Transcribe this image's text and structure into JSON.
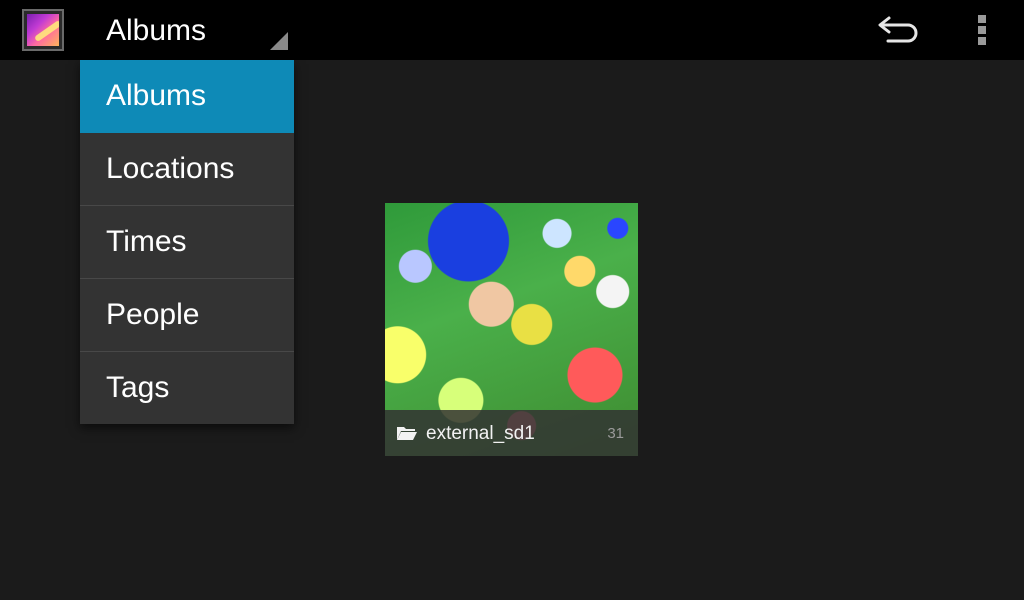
{
  "action_bar": {
    "title": "Albums",
    "app_icon": "gallery-icon",
    "back_icon": "back-arrow-icon",
    "overflow_icon": "overflow-menu-icon"
  },
  "dropdown": {
    "items": [
      {
        "label": "Albums",
        "selected": true
      },
      {
        "label": "Locations",
        "selected": false
      },
      {
        "label": "Times",
        "selected": false
      },
      {
        "label": "People",
        "selected": false
      },
      {
        "label": "Tags",
        "selected": false
      }
    ]
  },
  "albums": [
    {
      "name": "external_sd1",
      "count": "31",
      "icon": "folder-icon"
    }
  ],
  "colors": {
    "accent": "#0e8ab7",
    "background": "#1b1b1b",
    "action_bar": "#000000",
    "menu": "#333333"
  }
}
